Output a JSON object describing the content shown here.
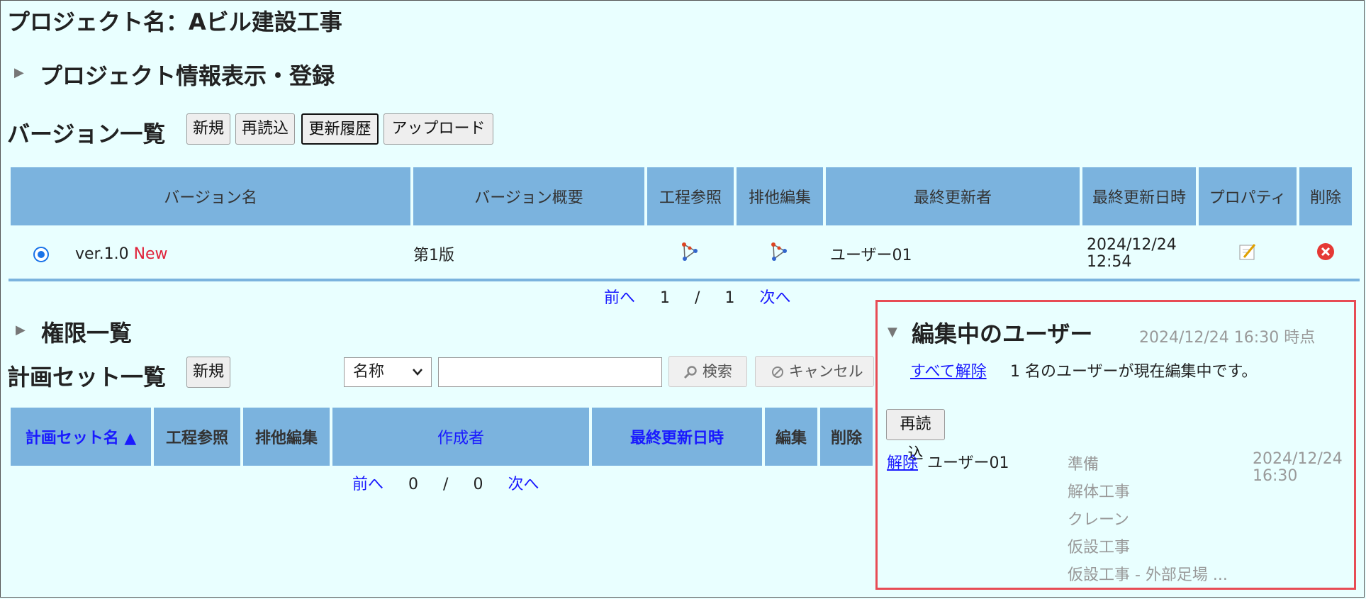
{
  "project_title": "プロジェクト名：Aビル建設工事",
  "project_info_section": "プロジェクト情報表示・登録",
  "versions": {
    "heading": "バージョン一覧",
    "buttons": {
      "new": "新規",
      "reload": "再読込",
      "history": "更新履歴",
      "upload": "アップロード"
    },
    "columns": [
      "バージョン名",
      "バージョン概要",
      "工程参照",
      "排他編集",
      "最終更新者",
      "最終更新日時",
      "プロパティ",
      "削除"
    ],
    "rows": [
      {
        "name": "ver.1.0",
        "badge": "New",
        "summary": "第1版",
        "updater": "ユーザー01",
        "updated_date": "2024/12/24",
        "updated_time": "12:54"
      }
    ],
    "pager": {
      "prev": "前へ",
      "current": "1",
      "sep": "/",
      "total": "1",
      "next": "次へ"
    }
  },
  "permissions_section": "権限一覧",
  "plansets": {
    "heading": "計画セット一覧",
    "new_button": "新規",
    "search_select": "名称",
    "search_value": "",
    "search_button": "検索",
    "cancel_button": "キャンセル",
    "columns": [
      "計画セット名 ▲",
      "工程参照",
      "排他編集",
      "作成者",
      "最終更新日時",
      "編集",
      "削除"
    ],
    "pager": {
      "prev": "前へ",
      "current": "0",
      "sep": "/",
      "total": "0",
      "next": "次へ"
    }
  },
  "editing_panel": {
    "title": "編集中のユーザー",
    "as_of": "2024/12/24 16:30 時点",
    "release_all": "すべて解除",
    "status_text": "1 名のユーザーが現在編集中です。",
    "reload": "再読込",
    "entry": {
      "release": "解除",
      "user": "ユーザー01",
      "items": [
        "準備",
        "解体工事",
        "クレーン",
        "仮設工事",
        "仮設工事 - 外部足場 ..."
      ],
      "date": "2024/12/24",
      "time": "16:30"
    }
  },
  "colors": {
    "background": "#e9ffff",
    "header": "#7bb3de",
    "link": "#1a1aff",
    "new_badge": "#e0223a",
    "highlight_border": "#e74c55"
  }
}
